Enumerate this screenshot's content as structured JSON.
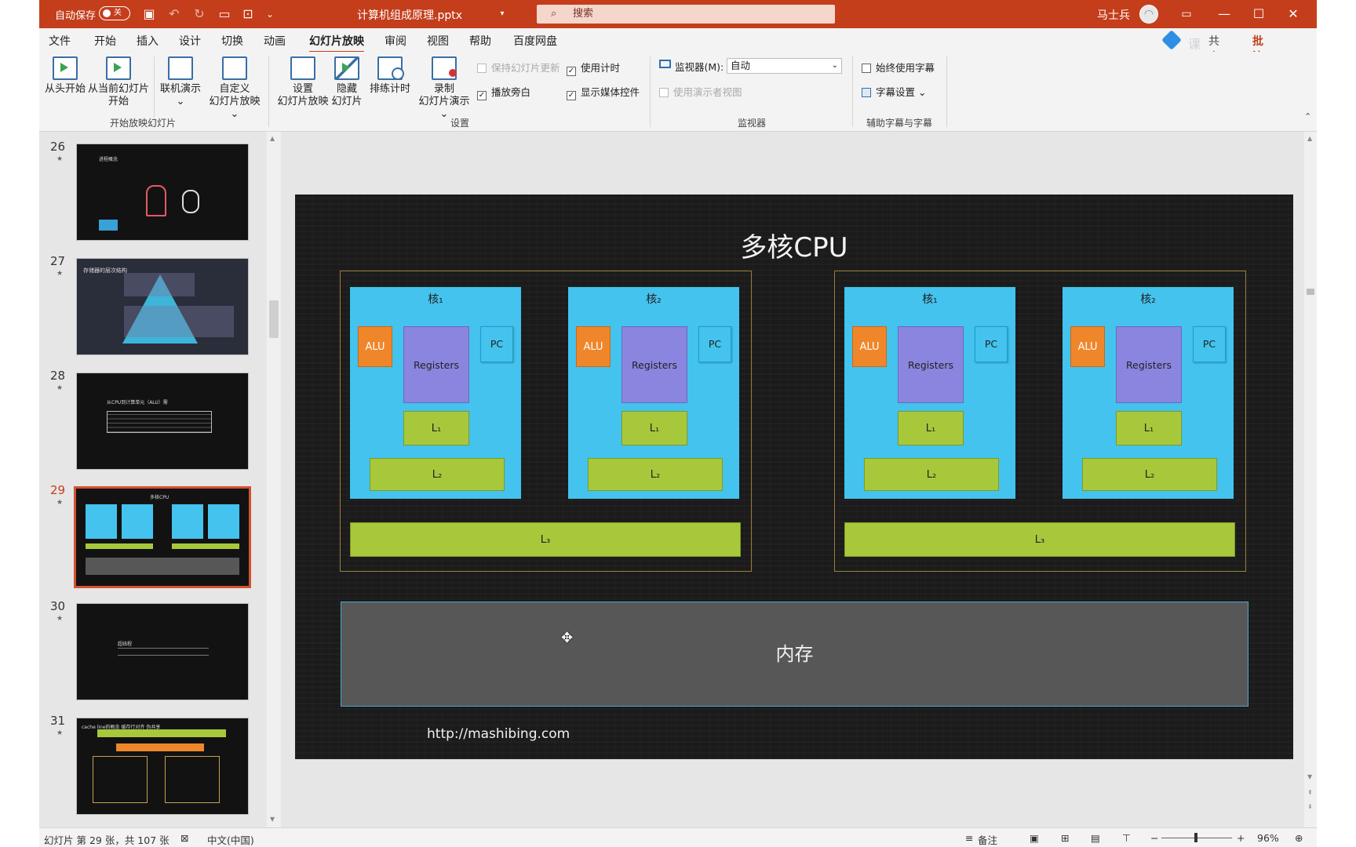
{
  "titlebar": {
    "autosave_label": "自动保存",
    "autosave_state": "关",
    "filename": "计算机组成原理.pptx",
    "search_placeholder": "搜索",
    "user_name": "马士兵"
  },
  "menu": {
    "tabs": [
      "文件",
      "开始",
      "插入",
      "设计",
      "切换",
      "动画",
      "幻灯片放映",
      "审阅",
      "视图",
      "帮助",
      "百度网盘"
    ],
    "active_tab": "幻灯片放映",
    "share_label": "共享",
    "comment_label": "批注",
    "brand_text": "课堂"
  },
  "ribbon": {
    "start_group": {
      "label": "开始放映幻灯片",
      "from_beginning": "从头开始",
      "from_current_1": "从当前幻灯片",
      "from_current_2": "开始",
      "online_1": "联机演示",
      "online_2": "⌄",
      "custom_1": "自定义",
      "custom_2": "幻灯片放映 ⌄"
    },
    "setup_group": {
      "label": "设置",
      "setup_1": "设置",
      "setup_2": "幻灯片放映",
      "hide_1": "隐藏",
      "hide_2": "幻灯片",
      "rehearse": "排练计时",
      "record_1": "录制",
      "record_2": "幻灯片演示 ⌄",
      "keep_updated": "保持幻灯片更新",
      "play_narration": "播放旁白",
      "use_timings": "使用计时",
      "show_media": "显示媒体控件"
    },
    "monitor_group": {
      "label": "监视器",
      "monitor_label": "监视器(M):",
      "monitor_value": "自动",
      "presenter_view": "使用演示者视图"
    },
    "caption_group": {
      "label": "辅助字幕与字幕",
      "always_subtitles": "始终使用字幕",
      "subtitle_settings": "字幕设置 ⌄"
    }
  },
  "thumbnails": [
    {
      "num": "26",
      "title": "进程概念"
    },
    {
      "num": "27",
      "title": "存储器的层次结构"
    },
    {
      "num": "28",
      "title": "从CPU到计算单元（ALU）需"
    },
    {
      "num": "29",
      "title": "多核CPU"
    },
    {
      "num": "30",
      "title": "超线程"
    },
    {
      "num": "31",
      "title": "cache line的概念 缓存行对齐 伪共享"
    }
  ],
  "slide": {
    "title": "多核CPU",
    "core1_label": "核₁",
    "core2_label": "核₂",
    "alu": "ALU",
    "registers": "Registers",
    "pc": "PC",
    "l1": "L₁",
    "l2": "L₂",
    "l3": "L₃",
    "memory": "内存",
    "url": "http://mashibing.com"
  },
  "status": {
    "slide_info": "幻灯片 第 29 张，共 107 张",
    "language": "中文(中国)",
    "notes": "备注",
    "zoom": "96%"
  },
  "colors": {
    "accent": "#c43e1c",
    "core_blue": "#43c3ee",
    "alu_orange": "#f0862a",
    "registers_purple": "#8a85de",
    "cache_green": "#a8c83c",
    "memory_gray": "#575757"
  }
}
